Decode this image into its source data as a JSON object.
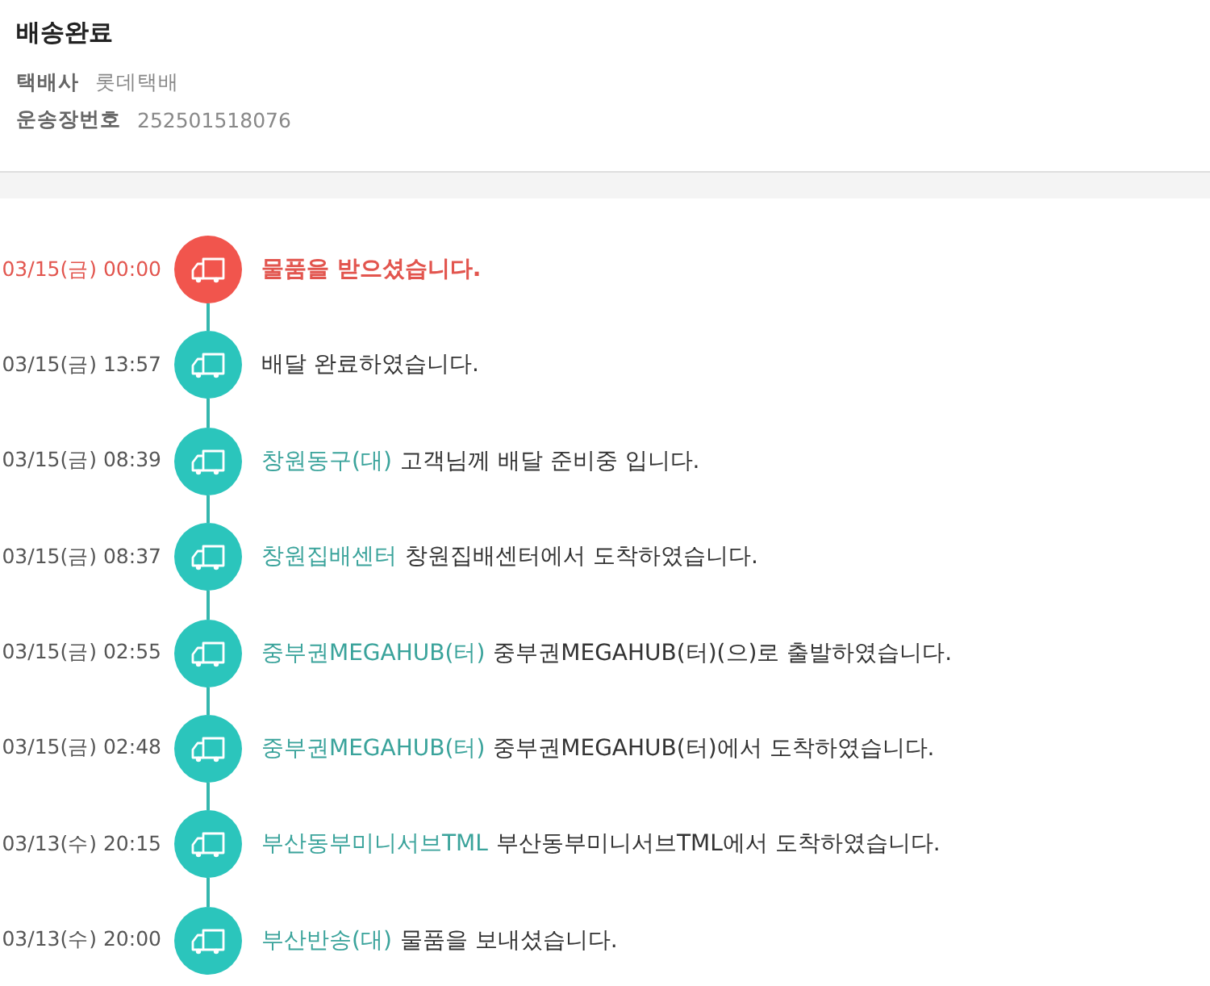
{
  "header": {
    "title": "배송완료",
    "fields": [
      {
        "label": "택배사",
        "value": "롯데택배"
      },
      {
        "label": "운송장번호",
        "value": "252501518076"
      }
    ]
  },
  "events": [
    {
      "time": "03/15(금) 00:00",
      "current": true,
      "message": "물품을 받으셨습니다."
    },
    {
      "time": "03/15(금) 13:57",
      "current": false,
      "message": "배달 완료하였습니다."
    },
    {
      "time": "03/15(금) 08:39",
      "current": false,
      "location": "창원동구(대)",
      "message": "고객님께 배달 준비중 입니다."
    },
    {
      "time": "03/15(금) 08:37",
      "current": false,
      "location": "창원집배센터",
      "message": "창원집배센터에서 도착하였습니다."
    },
    {
      "time": "03/15(금) 02:55",
      "current": false,
      "location": "중부권MEGAHUB(터)",
      "message": "중부권MEGAHUB(터)(으)로 출발하였습니다."
    },
    {
      "time": "03/15(금) 02:48",
      "current": false,
      "location": "중부권MEGAHUB(터)",
      "message": "중부권MEGAHUB(터)에서 도착하였습니다."
    },
    {
      "time": "03/13(수) 20:15",
      "current": false,
      "location": "부산동부미니서브TML",
      "message": "부산동부미니서브TML에서 도착하였습니다."
    },
    {
      "time": "03/13(수) 20:00",
      "current": false,
      "location": "부산반송(대)",
      "message": "물품을 보내셨습니다."
    }
  ]
}
